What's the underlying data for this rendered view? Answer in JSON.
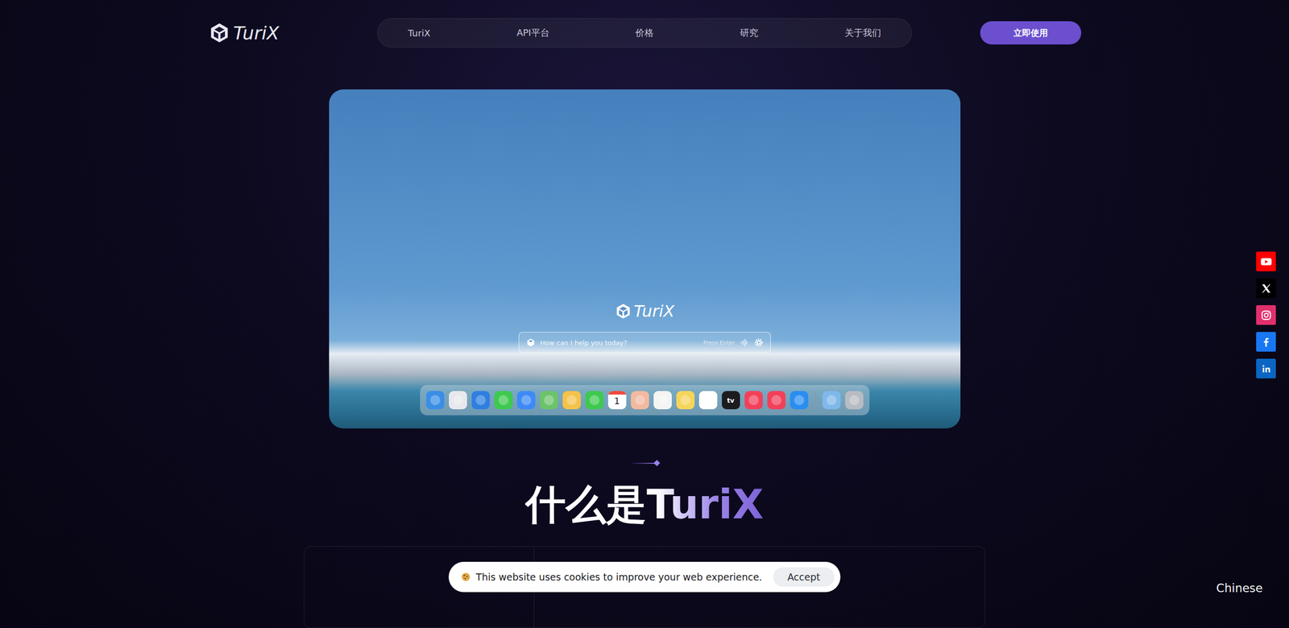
{
  "header": {
    "logo": "TuriX",
    "nav": [
      {
        "label": "TuriX"
      },
      {
        "label": "API平台"
      },
      {
        "label": "价格"
      },
      {
        "label": "研究"
      },
      {
        "label": "关于我们"
      }
    ],
    "cta": "立即使用"
  },
  "hero": {
    "logo": "TuriX",
    "search": {
      "placeholder": "How can I help you today?",
      "hint": "Press Enter"
    },
    "dock": [
      {
        "kind": "app",
        "color": "#3a8ee6"
      },
      {
        "kind": "app",
        "color": "#e8e8ec"
      },
      {
        "kind": "app",
        "color": "#2f7fe0"
      },
      {
        "kind": "app",
        "color": "#3ec94f"
      },
      {
        "kind": "app",
        "color": "#3d8af5"
      },
      {
        "kind": "app",
        "color": "#6cc36a"
      },
      {
        "kind": "app",
        "color": "#f5c24a"
      },
      {
        "kind": "app",
        "color": "#3ec94f"
      },
      {
        "kind": "calendar",
        "color": "#ffffff",
        "text": "1"
      },
      {
        "kind": "app",
        "color": "#f3b9a0"
      },
      {
        "kind": "app",
        "color": "#f4f4f4"
      },
      {
        "kind": "app",
        "color": "#f7d45a"
      },
      {
        "kind": "app",
        "color": "#ffffff"
      },
      {
        "kind": "tv",
        "color": "#1c1c1e",
        "text": "tv"
      },
      {
        "kind": "app",
        "color": "#f2405a"
      },
      {
        "kind": "app",
        "color": "#f2405a"
      },
      {
        "kind": "app",
        "color": "#2a8ef0"
      },
      {
        "kind": "separator",
        "color": "#8a98a8"
      },
      {
        "kind": "app",
        "color": "#7fb8ea"
      },
      {
        "kind": "app",
        "color": "#b8bcc2"
      }
    ]
  },
  "section": {
    "title": "什么是TuriX"
  },
  "social": [
    {
      "kind": "youtube",
      "color": "#ff0000"
    },
    {
      "kind": "x",
      "color": "#000000"
    },
    {
      "kind": "instagram",
      "color": "#e1306c"
    },
    {
      "kind": "facebook",
      "color": "#1877f2"
    },
    {
      "kind": "linkedin",
      "color": "#0a66c2"
    }
  ],
  "cookie": {
    "text": "This website uses cookies to improve your web experience.",
    "button": "Accept"
  },
  "language": "Chinese"
}
